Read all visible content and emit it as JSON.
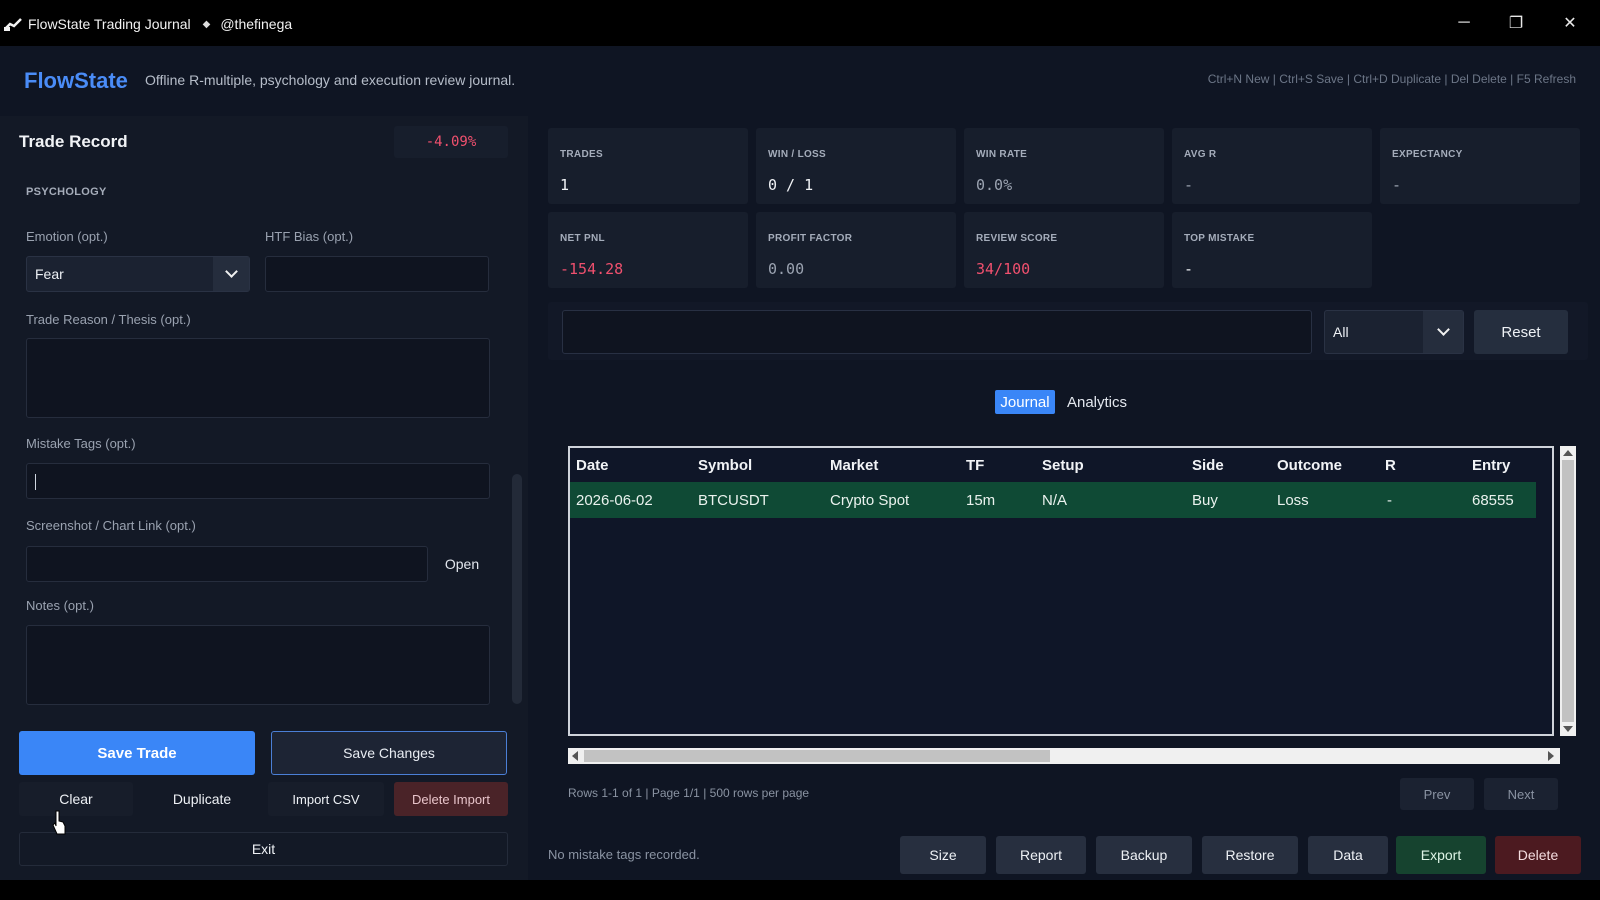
{
  "window": {
    "title": "FlowState Trading Journal",
    "separator": "◆",
    "handle": "@thefinega",
    "controls": {
      "minimize": "─",
      "restore": "❐",
      "close": "✕"
    }
  },
  "header": {
    "brand": "FlowState",
    "tagline": "Offline R-multiple, psychology and execution review journal.",
    "shortcuts": "Ctrl+N New | Ctrl+S Save | Ctrl+D Duplicate | Del Delete | F5 Refresh"
  },
  "left": {
    "title": "Trade Record",
    "pnl_pct": "-4.09%",
    "section": "PSYCHOLOGY",
    "emotion_label": "Emotion (opt.)",
    "emotion_value": "Fear",
    "htf_label": "HTF Bias (opt.)",
    "htf_value": "",
    "reason_label": "Trade Reason / Thesis (opt.)",
    "mistake_label": "Mistake Tags (opt.)",
    "screenshot_label": "Screenshot / Chart Link (opt.)",
    "open_label": "Open",
    "notes_label": "Notes (opt.)",
    "buttons": {
      "save_trade": "Save Trade",
      "save_changes": "Save Changes",
      "clear": "Clear",
      "duplicate": "Duplicate",
      "import_csv": "Import CSV",
      "delete_import": "Delete Import",
      "exit": "Exit"
    }
  },
  "stats": {
    "trades_label": "TRADES",
    "trades": "1",
    "winloss_label": "WIN / LOSS",
    "winloss": "0 / 1",
    "winrate_label": "WIN RATE",
    "winrate": "0.0%",
    "avgr_label": "AVG R",
    "avgr": "-",
    "expectancy_label": "EXPECTANCY",
    "expectancy": "-",
    "netpnl_label": "NET PNL",
    "netpnl": "-154.28",
    "pf_label": "PROFIT FACTOR",
    "pf": "0.00",
    "review_label": "REVIEW SCORE",
    "review": "34/100",
    "topmistake_label": "TOP MISTAKE",
    "topmistake": "-"
  },
  "filter": {
    "search_value": "",
    "dropdown": "All",
    "reset": "Reset"
  },
  "tabs": {
    "journal": "Journal",
    "analytics": "Analytics"
  },
  "table": {
    "columns": [
      "Date",
      "Symbol",
      "Market",
      "TF",
      "Setup",
      "Side",
      "Outcome",
      "R",
      "Entry"
    ],
    "rows": [
      [
        "2026-06-02",
        "BTCUSDT",
        "Crypto Spot",
        "15m",
        "N/A",
        "Buy",
        "Loss",
        "-",
        "68555"
      ]
    ]
  },
  "pagination": {
    "info": "Rows 1-1 of 1  |  Page 1/1  |  500 rows per page",
    "prev": "Prev",
    "next": "Next"
  },
  "footer": {
    "status": "No mistake tags recorded.",
    "buttons": {
      "size": "Size",
      "report": "Report",
      "backup": "Backup",
      "restore": "Restore",
      "data": "Data",
      "export": "Export",
      "delete": "Delete"
    }
  },
  "colors": {
    "accent": "#3a86f7",
    "brand": "#4a8cf7",
    "negative": "#f0506e",
    "row_selected": "#0f4a35",
    "export": "#16432f",
    "delete": "#4c1a20"
  }
}
